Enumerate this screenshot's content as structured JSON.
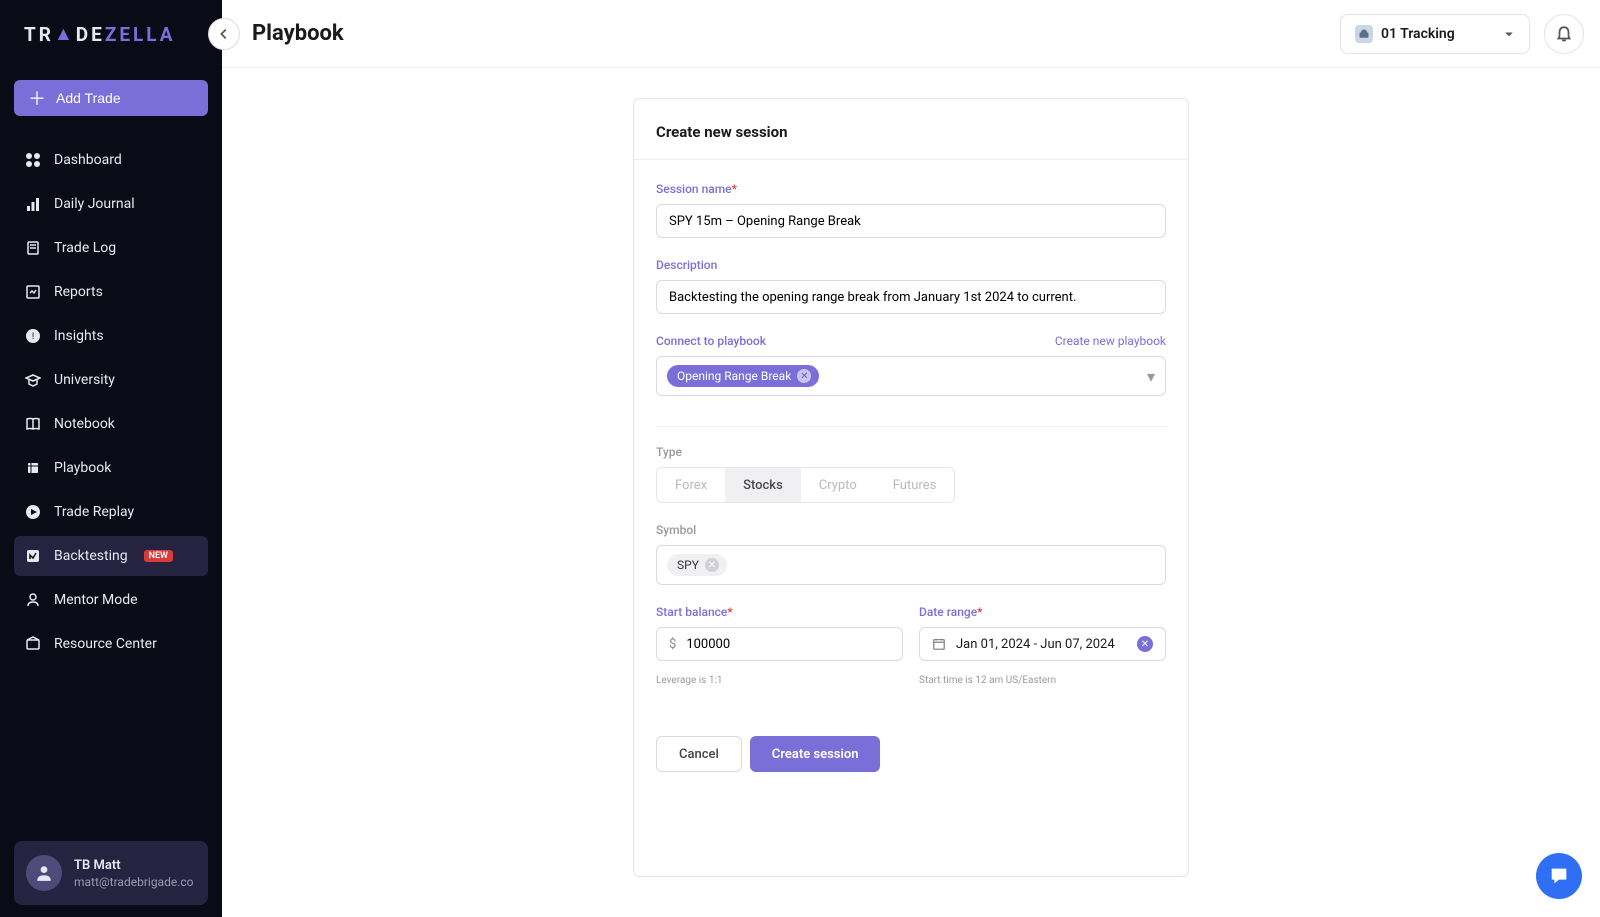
{
  "brand": "TRADEZELLA",
  "sidebar": {
    "add_trade": "Add Trade",
    "items": [
      {
        "label": "Dashboard"
      },
      {
        "label": "Daily Journal"
      },
      {
        "label": "Trade Log"
      },
      {
        "label": "Reports"
      },
      {
        "label": "Insights"
      },
      {
        "label": "University"
      },
      {
        "label": "Notebook"
      },
      {
        "label": "Playbook"
      },
      {
        "label": "Trade Replay"
      },
      {
        "label": "Backtesting",
        "badge": "NEW",
        "active": true
      },
      {
        "label": "Mentor Mode"
      },
      {
        "label": "Resource Center"
      }
    ]
  },
  "profile": {
    "name": "TB Matt",
    "email": "matt@tradebrigade.co"
  },
  "header": {
    "title": "Playbook",
    "account": "01 Tracking"
  },
  "form": {
    "card_title": "Create new session",
    "session_name": {
      "label": "Session name",
      "value": "SPY 15m – Opening Range Break"
    },
    "description": {
      "label": "Description",
      "value": "Backtesting the opening range break from January 1st 2024 to current."
    },
    "connect_playbook": {
      "label": "Connect to playbook",
      "create_link": "Create new playbook",
      "selected": "Opening Range Break"
    },
    "type": {
      "label": "Type",
      "options": [
        "Forex",
        "Stocks",
        "Crypto",
        "Futures"
      ],
      "selected": "Stocks"
    },
    "symbol": {
      "label": "Symbol",
      "selected": "SPY"
    },
    "start_balance": {
      "label": "Start balance",
      "value": "100000",
      "hint": "Leverage is 1:1"
    },
    "date_range": {
      "label": "Date range",
      "value": "Jan 01, 2024 - Jun 07, 2024",
      "hint": "Start time is 12 am US/Eastern"
    },
    "buttons": {
      "cancel": "Cancel",
      "create": "Create session"
    }
  }
}
